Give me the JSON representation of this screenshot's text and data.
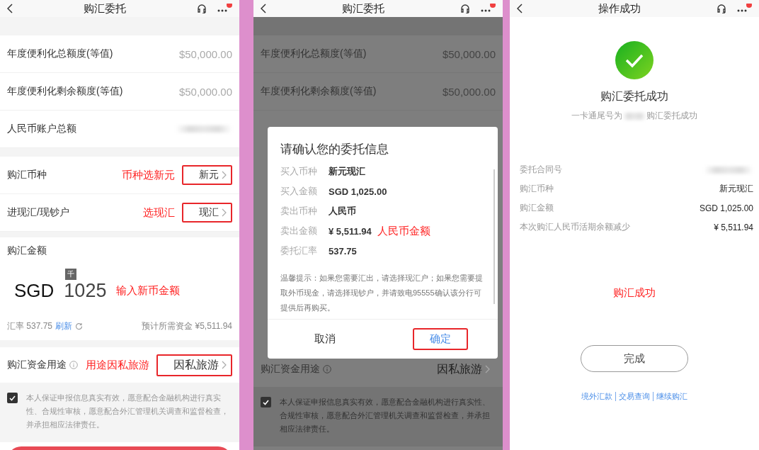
{
  "entrust_screen": {
    "nav": {
      "title": "购汇委托"
    },
    "quota_rows": [
      {
        "label": "年度便利化总额度(等值)",
        "value": "$50,000.00",
        "value_hidden": false
      },
      {
        "label": "年度便利化剩余额度(等值)",
        "value": "$50,000.00",
        "value_hidden": false
      },
      {
        "label": "人民币账户总额",
        "value_hidden": true
      }
    ],
    "select_rows": [
      {
        "label": "购汇币种",
        "annotation": "币种选新元",
        "value": "新元",
        "highlighted": true
      },
      {
        "label": "进现汇/现钞户",
        "annotation": "选现汇",
        "value": "现汇",
        "highlighted": true
      }
    ],
    "amount": {
      "label": "购汇金额",
      "currency": "SGD",
      "key_hint": "千",
      "value": "1025",
      "annotation": "输入新币金额"
    },
    "rate": {
      "label": "汇率 537.75",
      "refresh": "刷新",
      "estimate": "预计所需资金 ¥5,511.94"
    },
    "purpose": {
      "label": "购汇资金用途",
      "annotation": "用途因私旅游",
      "value": "因私旅游",
      "highlighted": true
    },
    "agreement": {
      "checked": true,
      "text": "本人保证申报信息真实有效，愿意配合金融机构进行真实性、合规性审核，愿意配合外汇管理机关调查和监督检查，并承担相应法律责任。"
    }
  },
  "confirm_screen": {
    "nav": {
      "title": "购汇委托"
    },
    "quota_rows": [
      {
        "label": "年度便利化总额度(等值)",
        "value": "$50,000.00"
      },
      {
        "label": "年度便利化剩余额度(等值)",
        "value": "$50,000.00"
      }
    ],
    "dialog": {
      "title": "请确认您的委托信息",
      "rows": [
        {
          "label": "买入币种",
          "value": "新元现汇"
        },
        {
          "label": "买入金额",
          "value": "SGD 1,025.00"
        },
        {
          "label": "卖出币种",
          "value": "人民币"
        },
        {
          "label": "卖出金额",
          "value": "¥ 5,511.94",
          "annotation": "人民币金额"
        },
        {
          "label": "委托汇率",
          "value": "537.75"
        }
      ],
      "tip": "温馨提示：如果您需要汇出，请选择现汇户；如果您需要提取外币现金，请选择现钞户，并请致电95555确认该分行可提供后再购买。",
      "cancel": "取消",
      "confirm": "确定",
      "confirm_highlighted": true
    },
    "purpose": {
      "label": "购汇资金用途",
      "value": "因私旅游"
    },
    "agreement": {
      "checked": true,
      "text": "本人保证申报信息真实有效，愿意配合金融机构进行真实性、合规性审核，愿意配合外汇管理机关调查和监督检查，并承担相应法律责任。"
    }
  },
  "success_screen": {
    "nav": {
      "title": "操作成功"
    },
    "heading": "购汇委托成功",
    "subtitle_prefix": "一卡通尾号为",
    "subtitle_suffix": "购汇委托成功",
    "details": [
      {
        "label": "委托合同号",
        "value_hidden": true
      },
      {
        "label": "购汇币种",
        "value": "新元现汇",
        "value_hidden": false
      },
      {
        "label": "购汇金额",
        "value": "SGD 1,025.00",
        "value_hidden": false
      },
      {
        "label": "本次购汇人民币活期余额减少",
        "value": "¥ 5,511.94",
        "value_hidden": false
      }
    ],
    "annotation": "购汇成功",
    "done_button": "完成",
    "links": [
      "境外汇款",
      "交易查询",
      "继续购汇"
    ]
  }
}
